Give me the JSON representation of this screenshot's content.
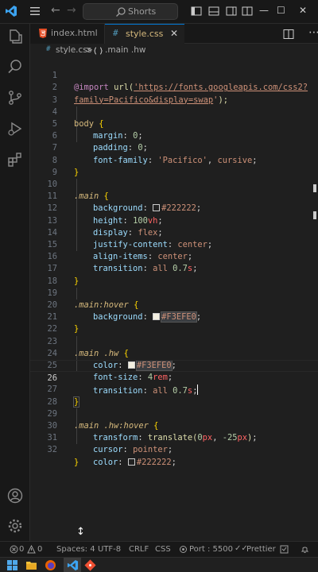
{
  "titlebar": {
    "search_text": "Shorts",
    "icons": [
      "vscode-logo-icon",
      "hamburger-menu-icon",
      "back-arrow-icon",
      "forward-arrow-icon",
      "search-icon",
      "toggle-sidebar-icon",
      "toggle-panel-icon",
      "toggle-secondary-sidebar-icon",
      "customize-layout-icon",
      "minimize-icon",
      "maximize-icon",
      "close-icon"
    ]
  },
  "activity_bar": {
    "items": [
      "explorer-icon",
      "search-icon",
      "source-control-icon",
      "run-debug-icon",
      "extensions-icon"
    ],
    "bottom": [
      "accounts-icon",
      "manage-gear-icon"
    ]
  },
  "tabs": [
    {
      "label": "index.html",
      "icon": "html5-icon",
      "active": false
    },
    {
      "label": "style.css",
      "icon": "css-braces-icon",
      "active": true,
      "close": "✕"
    }
  ],
  "breadcrumb": {
    "file": "style.css",
    "separator": ">",
    "symbol": ".main .hw"
  },
  "editor": {
    "lines": [
      "1",
      "2",
      "3",
      "4",
      "5",
      "6",
      "7",
      "8",
      "9",
      "10",
      "11",
      "12",
      "13",
      "14",
      "15",
      "16",
      "17",
      "18",
      "19",
      "20",
      "21",
      "22",
      "23",
      "24",
      "25",
      "26",
      "27",
      "28",
      "29",
      "30",
      "31",
      "32"
    ],
    "code": {
      "l1_at": "@import",
      "l1_url_fn": "url(",
      "l1_url_str1": "'https://fonts.googleapis.com/css2?",
      "l2_url_str2": "family=Pacifico&display=swap",
      "l2_tail_quote": "'",
      "l2_close": ");",
      "body_sel": "body",
      "brace_open": " {",
      "brace_close": "}",
      "p_margin": "margin",
      "p_padding": "padding",
      "p_font_family": "font-family",
      "v_zero": "0",
      "v_pacifico": "'Pacifico'",
      "v_cursive": "cursive",
      "main_sel": ".main",
      "p_background": "background",
      "v_222": "#222222",
      "p_height": "height",
      "v_100": "100",
      "u_vh": "vh",
      "p_display": "display",
      "v_flex": "flex",
      "p_justify": "justify-content",
      "v_center": "center",
      "p_align": "align-items",
      "p_transition": "transition",
      "v_all": "all",
      "v_07": "0.7",
      "u_s": "s",
      "main_hover_sel": ".main:hover",
      "v_f3": "#F3EFE0",
      "main_hw_sel": ".main .hw",
      "p_color": "color",
      "p_font_size": "font-size",
      "v_4": "4",
      "u_rem": "rem",
      "main_hw_hover_sel": ".main .hw:hover",
      "p_transform": "transform",
      "v_translate": "translate(",
      "v_0": "0",
      "u_px": "px",
      "v_m25": "-25",
      "p_cursor": "cursor",
      "v_pointer": "pointer",
      "colon": ":",
      "semi": ";",
      "comma": ",",
      "space": " ",
      "paren_close": ")"
    },
    "active_line": "25"
  },
  "statusbar": {
    "errors": "0",
    "warnings": "0",
    "spaces": "Spaces: 4",
    "encoding": "UTF-8",
    "eol": "CRLF",
    "language": "CSS",
    "port": "Port : 5500",
    "prettier": "Prettier"
  },
  "taskbar": {
    "icons": [
      "windows-start-icon",
      "file-explorer-icon",
      "firefox-icon",
      "vscode-taskbar-icon",
      "git-icon"
    ]
  },
  "colors": {
    "accent": "#0078d4",
    "editor_bg": "#1f1f1f",
    "chrome_bg": "#181818"
  }
}
